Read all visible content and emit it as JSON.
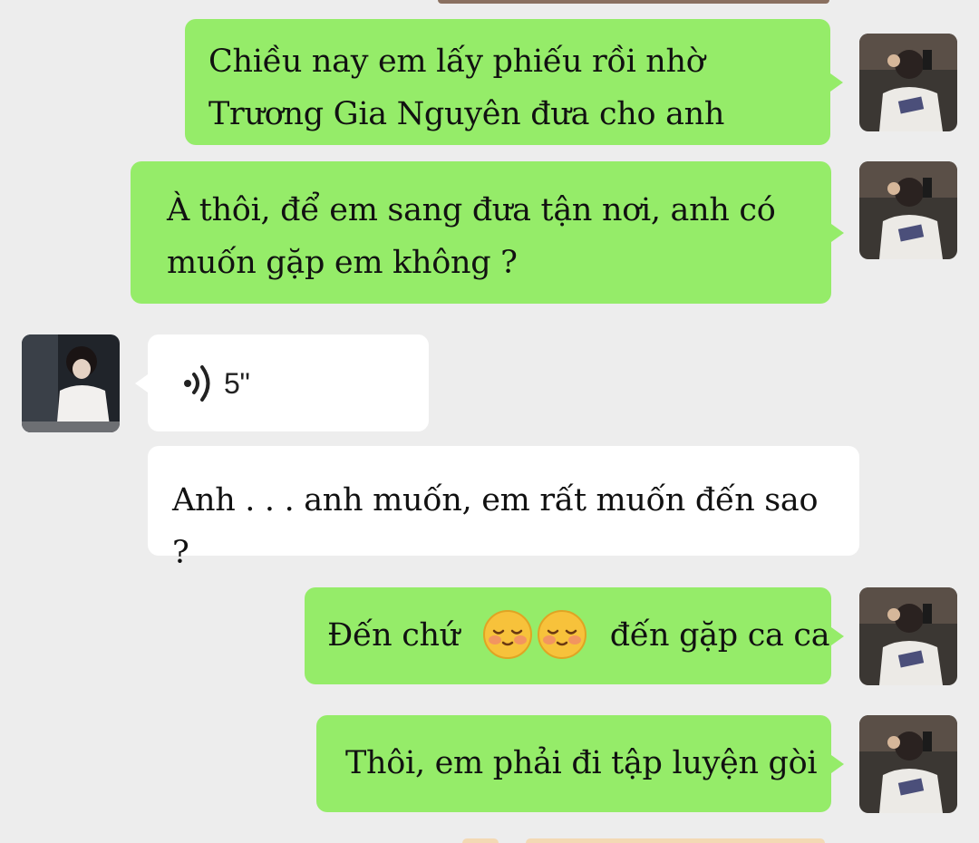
{
  "messages": [
    {
      "side": "right",
      "type": "text",
      "text": "Chiều nay em lấy phiếu rồi nhờ Trương Gia Nguyên đưa cho anh"
    },
    {
      "side": "right",
      "type": "text",
      "text": "À thôi, để em sang đưa tận nơi, anh có muốn gặp em không ?"
    },
    {
      "side": "left",
      "type": "voice",
      "duration": "5\"",
      "icon": "voice-wave-icon"
    },
    {
      "side": "left",
      "type": "text",
      "text": "Anh . . . anh muốn, em rất muốn đến sao ?"
    },
    {
      "side": "right",
      "type": "text_emoji",
      "before": "Đến chứ",
      "emojis": [
        "shy-blushing-face-emoji",
        "shy-blushing-face-emoji"
      ],
      "after": "đến gặp ca ca"
    },
    {
      "side": "right",
      "type": "text",
      "text": "Thôi, em phải đi tập luyện gòi"
    }
  ],
  "colors": {
    "background": "#ededed",
    "sent_bubble": "#95ec69",
    "received_bubble": "#ffffff",
    "text": "#111111"
  }
}
